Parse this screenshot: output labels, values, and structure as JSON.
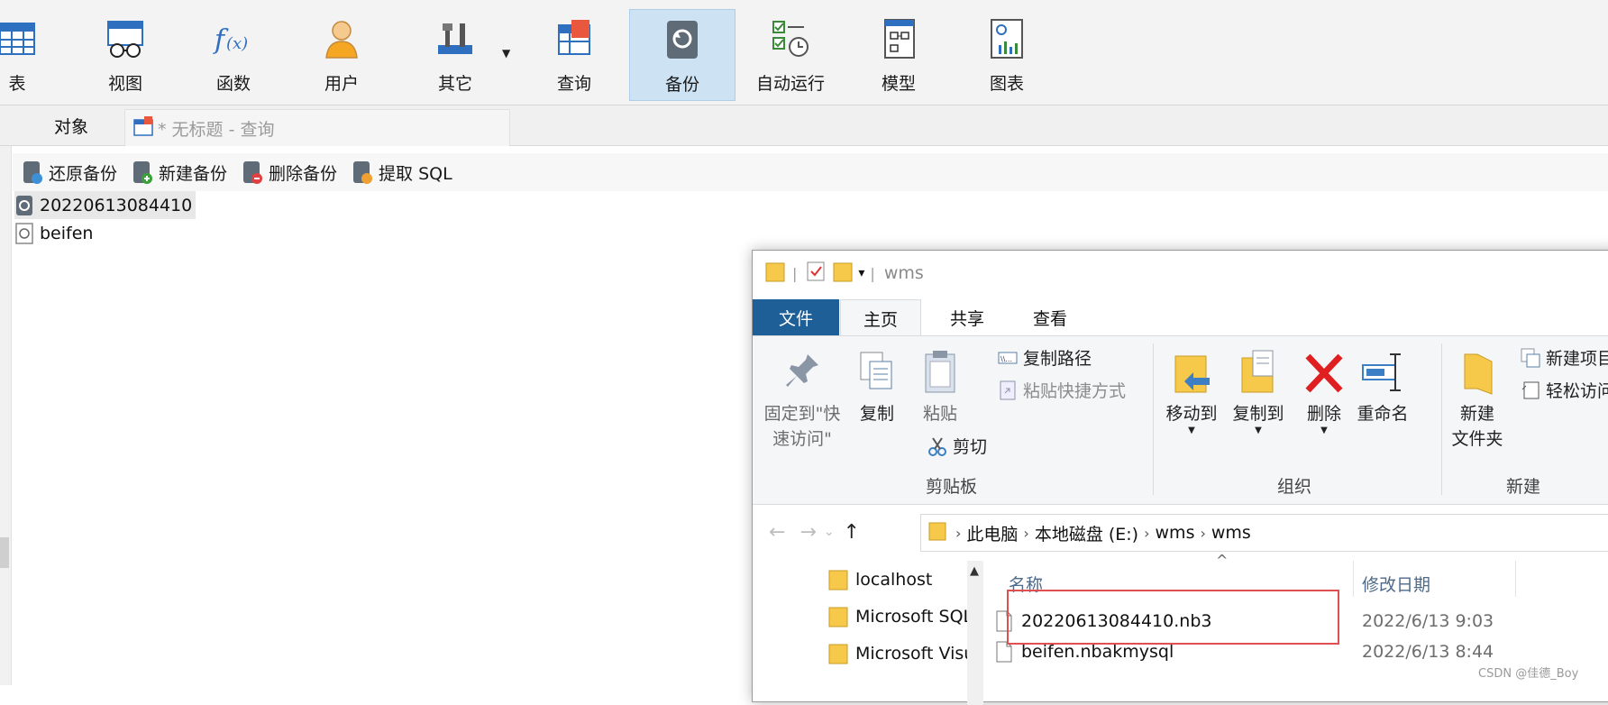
{
  "toolbar": {
    "items": [
      {
        "label": "表",
        "icon": "table-icon"
      },
      {
        "label": "视图",
        "icon": "view-icon"
      },
      {
        "label": "函数",
        "icon": "function-icon"
      },
      {
        "label": "用户",
        "icon": "user-icon"
      },
      {
        "label": "其它",
        "icon": "tools-icon"
      },
      {
        "label": "查询",
        "icon": "query-icon"
      },
      {
        "label": "备份",
        "icon": "backup-icon",
        "active": true
      },
      {
        "label": "自动运行",
        "icon": "schedule-icon"
      },
      {
        "label": "模型",
        "icon": "model-icon"
      },
      {
        "label": "图表",
        "icon": "chart-icon"
      }
    ]
  },
  "tabs": {
    "objects": "对象",
    "query": "* 无标题 - 查询"
  },
  "actions": {
    "restore": "还原备份",
    "new": "新建备份",
    "delete": "删除备份",
    "extract": "提取 SQL"
  },
  "backups": [
    {
      "name": "20220613084410",
      "selected": true
    },
    {
      "name": "beifen",
      "selected": false
    }
  ],
  "explorer": {
    "title": "wms",
    "ribbon_tabs": {
      "file": "文件",
      "home": "主页",
      "share": "共享",
      "view": "查看"
    },
    "ribbon": {
      "pin_line1": "固定到\"快",
      "pin_line2": "速访问\"",
      "copy": "复制",
      "paste": "粘贴",
      "copy_path": "复制路径",
      "paste_shortcut": "粘贴快捷方式",
      "cut": "剪切",
      "move_to": "移动到",
      "copy_to": "复制到",
      "delete": "删除",
      "rename": "重命名",
      "new_folder_line1": "新建",
      "new_folder_line2": "文件夹",
      "new_item": "新建项目",
      "easy_access": "轻松访问",
      "group_clipboard": "剪贴板",
      "group_organize": "组织",
      "group_new": "新建"
    },
    "address": {
      "crumbs": [
        "此电脑",
        "本地磁盘 (E:)",
        "wms",
        "wms"
      ]
    },
    "nav_pane": [
      "localhost",
      "Microsoft SQL Server",
      "Microsoft Visual Studio"
    ],
    "columns": {
      "name": "名称",
      "date": "修改日期"
    },
    "files": [
      {
        "name": "20220613084410.nb3",
        "date": "2022/6/13 9:03"
      },
      {
        "name": "beifen.nbakmysql",
        "date": "2022/6/13 8:44"
      }
    ]
  },
  "watermark": "CSDN @佳德_Boy",
  "colors": {
    "accent": "#1f5f97",
    "active_toolbar": "#cde3f4",
    "highlight_box": "#e05050",
    "folder": "#f6c94a"
  }
}
